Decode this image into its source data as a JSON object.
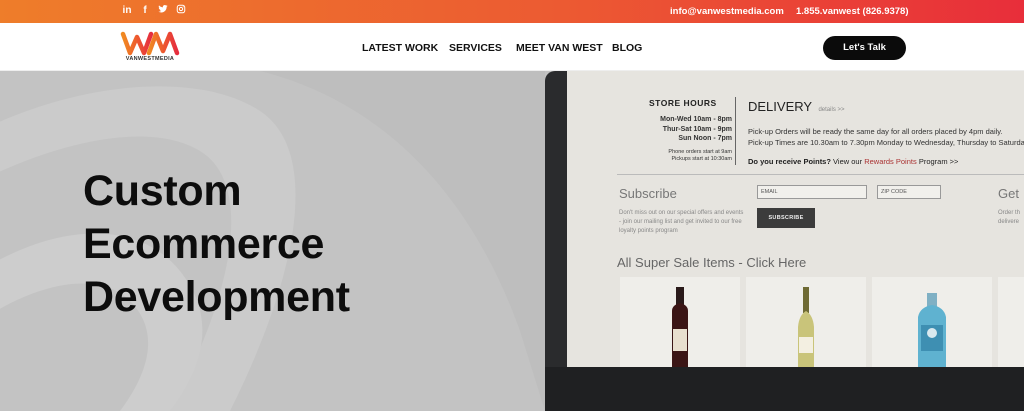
{
  "topbar": {
    "social": [
      {
        "icon": "linkedin-icon",
        "glyph": "in"
      },
      {
        "icon": "facebook-icon",
        "glyph": "f"
      },
      {
        "icon": "twitter-icon",
        "glyph": "🐦"
      },
      {
        "icon": "instagram-icon",
        "glyph": "◎"
      }
    ],
    "email": "info@vanwestmedia.com",
    "phone": "1.855.vanwest (826.9378)"
  },
  "nav": {
    "logo_word": "VANWESTMEDIA",
    "items": [
      "LATEST WORK",
      "SERVICES",
      "MEET VAN WEST",
      "BLOG"
    ],
    "cta": "Let's Talk"
  },
  "hero": {
    "title_lines": [
      "Custom",
      "Ecommerce",
      "Development"
    ]
  },
  "screen": {
    "store_hours_title": "STORE HOURS",
    "store_hours": [
      "Mon-Wed 10am - 8pm",
      "Thur-Sat 10am - 9pm",
      "Sun Noon - 7pm"
    ],
    "store_notes": [
      "Phone orders start at 9am",
      "Pickups start at 10:30am"
    ],
    "delivery_title": "DELIVERY",
    "delivery_details": "details >>",
    "delivery_lines": [
      "Pick-up Orders will be ready the same day for all orders placed by 4pm daily.",
      "Pick-up Times are 10.30am to 7.30pm Monday to Wednesday, Thursday to Saturday"
    ],
    "points_q": "Do you receive Points?",
    "points_view": "View our",
    "points_link": "Rewards Points",
    "points_rest": "Program >>",
    "subscribe_title": "Subscribe",
    "subscribe_text": "Don't miss out on our special offers and events - join our mailing list and get invited to our free loyalty points program",
    "email_placeholder": "EMAIL",
    "zip_placeholder": "ZIP CODE",
    "subscribe_button": "SUBSCRIBE",
    "get_title": "Get",
    "get_text_lines": [
      "Order th",
      "delivere"
    ],
    "sale_title": "All Super Sale Items - Click Here"
  },
  "colors": {
    "topbar_start": "#ee7d2a",
    "topbar_end": "#e82e3a",
    "cta_bg": "#0b0b0b",
    "hero_bg": "#c3c3c3"
  }
}
